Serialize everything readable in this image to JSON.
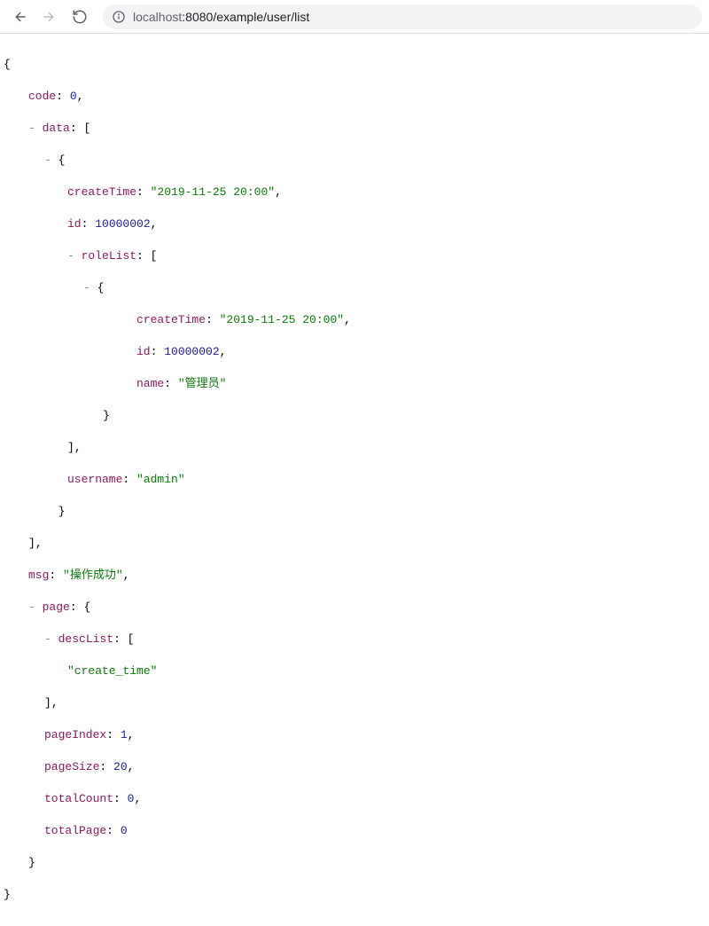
{
  "browser": {
    "url_host": "localhost",
    "url_port": ":8080",
    "url_path": "/example/user/list"
  },
  "json": {
    "code_key": "code",
    "code_val": "0",
    "data_key": "data",
    "createTime_key": "createTime",
    "createTime_val": "\"2019-11-25 20:00\"",
    "id_key": "id",
    "id_val": "10000002",
    "roleList_key": "roleList",
    "role_createTime_key": "createTime",
    "role_createTime_val": "\"2019-11-25 20:00\"",
    "role_id_key": "id",
    "role_id_val": "10000002",
    "role_name_key": "name",
    "role_name_val": "\"管理员\"",
    "username_key": "username",
    "username_val": "\"admin\"",
    "msg_key": "msg",
    "msg_val": "\"操作成功\"",
    "page_key": "page",
    "descList_key": "descList",
    "descList_val": "\"create_time\"",
    "pageIndex_key": "pageIndex",
    "pageIndex_val": "1",
    "pageSize_key": "pageSize",
    "pageSize_val": "20",
    "totalCount_key": "totalCount",
    "totalCount_val": "0",
    "totalPage_key": "totalPage",
    "totalPage_val": "0",
    "toggle": "-",
    "obr": "{",
    "cbr": "}",
    "osb": "[",
    "csb": "]",
    "colon": ": ",
    "comma": ","
  }
}
